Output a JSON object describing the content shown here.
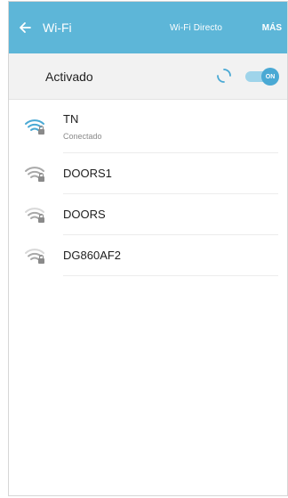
{
  "header": {
    "title": "Wi-Fi",
    "wifi_direct_label": "Wi-Fi Directo",
    "more_label": "MÁS"
  },
  "toggle": {
    "label": "Activado",
    "switch_label": "ON",
    "state": "on"
  },
  "networks": [
    {
      "name": "TN",
      "status": "Conectado",
      "secured": true,
      "signal": "full"
    },
    {
      "name": "DOORS1",
      "status": "",
      "secured": true,
      "signal": "full"
    },
    {
      "name": "DOORS",
      "status": "",
      "secured": true,
      "signal": "medium"
    },
    {
      "name": "DG860AF2",
      "status": "",
      "secured": true,
      "signal": "medium"
    }
  ],
  "colors": {
    "header": "#5db6d8",
    "accent": "#4aa9d4",
    "connected_icon": "#4aa9d4",
    "idle_icon": "#a9a9a9"
  }
}
